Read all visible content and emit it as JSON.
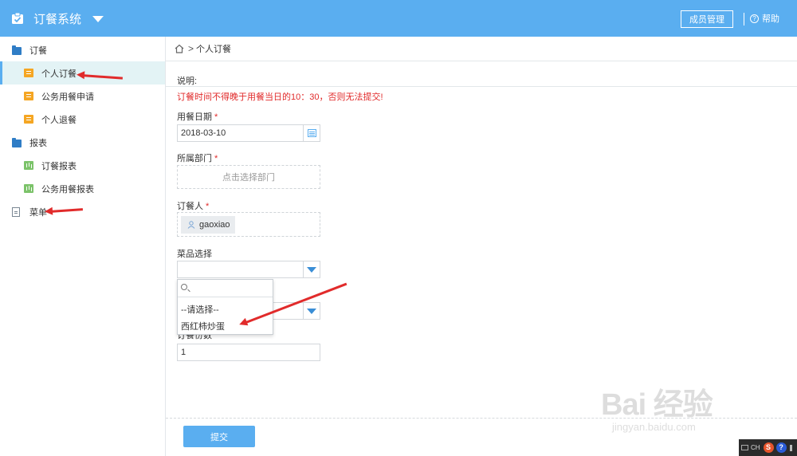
{
  "header": {
    "app_title": "订餐系统",
    "member_button": "成员管理",
    "help_label": "帮助",
    "help_icon_glyph": "?"
  },
  "sidebar": {
    "groups": [
      {
        "label": "订餐",
        "icon": "folder-open-icon"
      },
      {
        "label": "报表",
        "icon": "folder-open-icon"
      }
    ],
    "items": [
      {
        "label": "个人订餐",
        "icon": "form-icon",
        "active": true
      },
      {
        "label": "公务用餐申请",
        "icon": "form-icon"
      },
      {
        "label": "个人退餐",
        "icon": "form-icon"
      },
      {
        "label": "订餐报表",
        "icon": "bar-chart-icon"
      },
      {
        "label": "公务用餐报表",
        "icon": "bar-chart-icon"
      },
      {
        "label": "菜单",
        "icon": "document-icon"
      }
    ]
  },
  "breadcrumb": {
    "separator": ">",
    "current": "个人订餐"
  },
  "form": {
    "note_title": "说明:",
    "warning": "订餐时间不得晚于用餐当日的10：30，否则无法提交!",
    "required_mark": "*",
    "date_label": "用餐日期",
    "date_value": "2018-03-10",
    "dept_label": "所属部门",
    "dept_placeholder": "点击选择部门",
    "person_label": "订餐人",
    "person_name": "gaoxiao",
    "dish_label": "菜品选择",
    "quantity_label_partial": "订餐份数",
    "quantity_value": "1",
    "submit_label": "提交"
  },
  "dropdown": {
    "options": [
      "--请选择--",
      "西红柿炒蛋"
    ]
  },
  "watermark": {
    "brand": "Bai 经验",
    "url": "jingyan.baidu.com"
  },
  "tray": {
    "ime": "CH"
  },
  "colors": {
    "accent": "#5aaef0",
    "warning": "#e12b2b",
    "active_bg": "#e3f3f5"
  }
}
